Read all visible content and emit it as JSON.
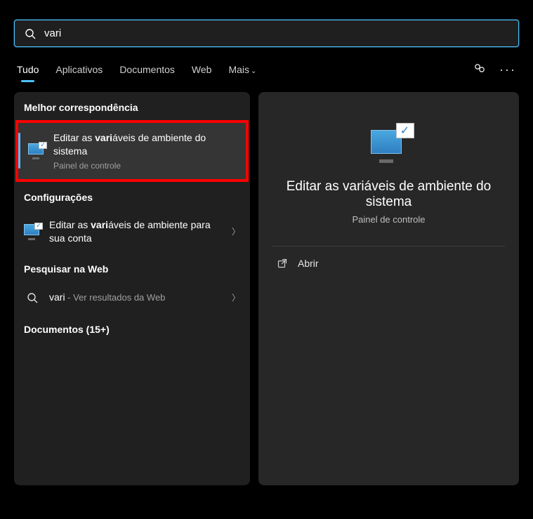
{
  "search": {
    "value": "vari"
  },
  "tabs": {
    "items": [
      "Tudo",
      "Aplicativos",
      "Documentos",
      "Web",
      "Mais"
    ],
    "activeIndex": 0
  },
  "sections": {
    "best": "Melhor correspondência",
    "settings": "Configurações",
    "web": "Pesquisar na Web",
    "docs": "Documentos (15+)"
  },
  "results": {
    "best": {
      "title_pre": "Editar as ",
      "title_bold": "vari",
      "title_post": "áveis de ambiente do sistema",
      "sub": "Painel de controle"
    },
    "settings": {
      "title_pre": "Editar as ",
      "title_bold": "vari",
      "title_post": "áveis de ambiente para sua conta"
    },
    "web": {
      "term": "vari",
      "suffix": " - Ver resultados da Web"
    }
  },
  "preview": {
    "title": "Editar as variáveis de ambiente do sistema",
    "sub": "Painel de controle",
    "action": "Abrir"
  }
}
